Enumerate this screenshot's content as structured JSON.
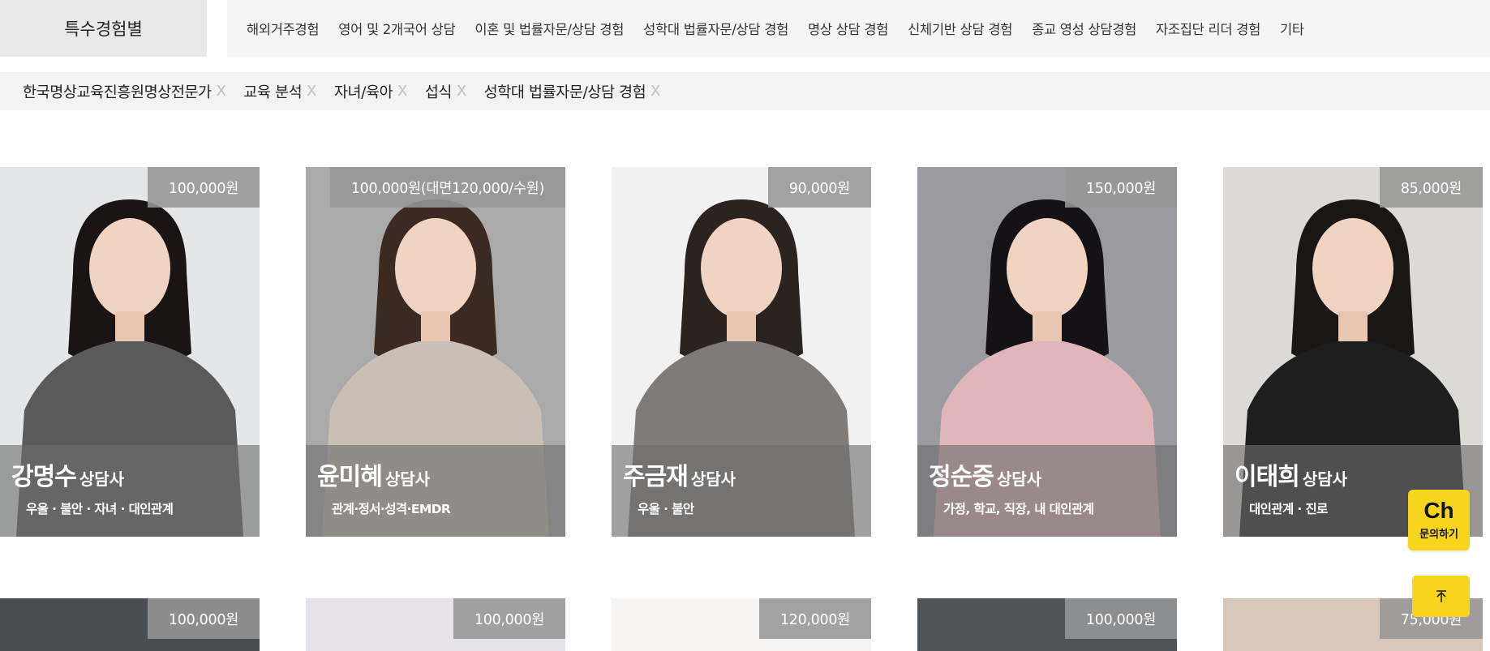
{
  "category": {
    "label": "특수경험별",
    "items": [
      "해외거주경험",
      "영어 및 2개국어 상담",
      "이혼 및 법률자문/상담 경험",
      "성학대 법률자문/상담 경험",
      "명상 상담 경험",
      "신체기반 상담 경험",
      "종교 영성 상담경험",
      "자조집단 리더 경험",
      "기타"
    ]
  },
  "filters": {
    "chips": [
      "한국명상교육진흥원명상전문가",
      "교육 분석",
      "자녀/육아",
      "섭식",
      "성학대 법률자문/상담 경험"
    ],
    "remove_glyph": "X"
  },
  "counselors": [
    {
      "name": "강명수",
      "role": "상담사",
      "specialty": "우울 · 불안 · 자녀 · 대인관계",
      "price": "100,000원",
      "bg": "#e4e6e8",
      "hair": "#1a1414",
      "top": "#5a5a5a"
    },
    {
      "name": "윤미혜",
      "role": "상담사",
      "specialty": "관계·정서·성격·EMDR",
      "price": "100,000원(대면120,000/수원)",
      "bg": "#a9aaa9",
      "hair": "#3a2a22",
      "top": "#c9bfb5"
    },
    {
      "name": "주금재",
      "role": "상담사",
      "specialty": "우울 · 불안",
      "price": "90,000원",
      "bg": "#f1f1f1",
      "hair": "#2a2320",
      "top": "#7f7b78"
    },
    {
      "name": "정순중",
      "role": "상담사",
      "specialty": "가정, 학교, 직장, 내 대인관계",
      "price": "150,000원",
      "bg": "#9a9aa0",
      "hair": "#141216",
      "top": "#e0b6bb"
    },
    {
      "name": "이태희",
      "role": "상담사",
      "specialty": "대인관계 · 진로",
      "price": "85,000원",
      "bg": "#dcdad6",
      "hair": "#1a1614",
      "top": "#1e1e1e"
    }
  ],
  "second_row": [
    {
      "price": "100,000원",
      "bg": "#4a4e52"
    },
    {
      "price": "100,000원",
      "bg": "#e6e2ea"
    },
    {
      "price": "120,000원",
      "bg": "#f6f4f2"
    },
    {
      "price": "100,000원",
      "bg": "#4e5458"
    },
    {
      "price": "75,000원",
      "bg": "#d8c8bc"
    }
  ],
  "floating": {
    "chat_logo": "Ch",
    "chat_label": "문의하기",
    "top_arrow": "↑"
  },
  "colors": {
    "accent": "#f7d51d"
  }
}
